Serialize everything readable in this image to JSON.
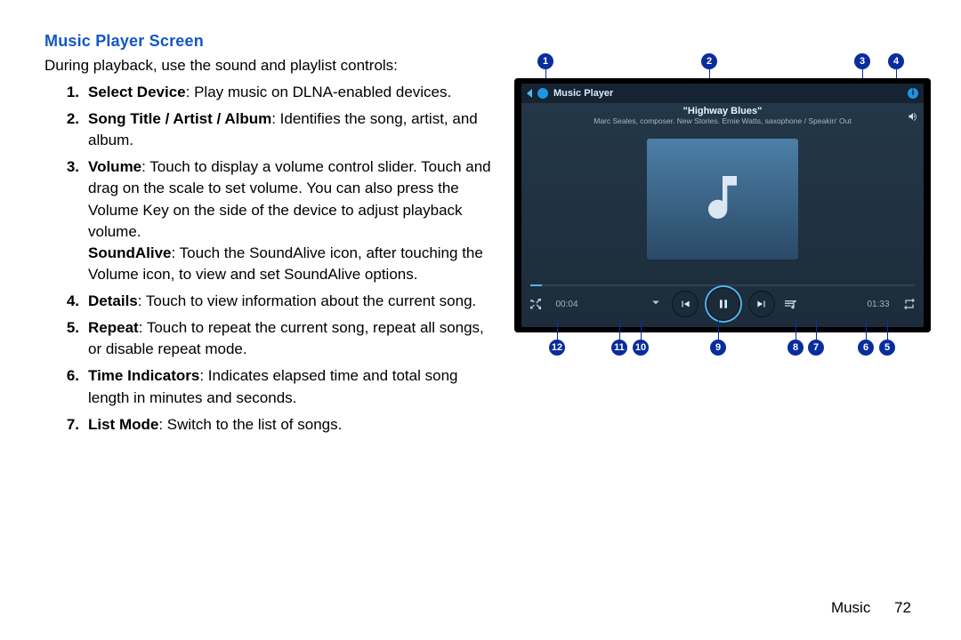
{
  "heading": "Music Player Screen",
  "intro": "During playback, use the sound and playlist controls:",
  "items": [
    {
      "num": "1.",
      "term": "Select Device",
      "rest": ": Play music on DLNA-enabled devices."
    },
    {
      "num": "2.",
      "term": "Song Title / Artist / Album",
      "rest": ": Identifies the song, artist, and album."
    },
    {
      "num": "3.",
      "term": "Volume",
      "rest": ": Touch to display a volume control slider. Touch and drag on the scale to set volume. You can also press the Volume Key on the side of the device to adjust playback volume.",
      "extra_term": "SoundAlive",
      "extra_rest": ": Touch the SoundAlive icon, after touching the Volume icon, to view and set SoundAlive options."
    },
    {
      "num": "4.",
      "term": "Details",
      "rest": ": Touch to view information about the current song."
    },
    {
      "num": "5.",
      "term": "Repeat",
      "rest": ": Touch to repeat the current song, repeat all songs, or disable repeat mode."
    },
    {
      "num": "6.",
      "term": "Time Indicators",
      "rest": ": Indicates elapsed time and total song length in minutes and seconds."
    },
    {
      "num": "7.",
      "term": "List Mode",
      "rest": ": Switch to the list of songs."
    }
  ],
  "footer": {
    "section": "Music",
    "page": "72"
  },
  "player": {
    "app_title": "Music Player",
    "song_title": "\"Highway Blues\"",
    "song_meta": "Marc Seales, composer. New Stories. Ernie Watts, saxophone / Speakin' Out",
    "elapsed": "00:04",
    "total": "01:33"
  },
  "callouts_top": [
    "1",
    "2",
    "3",
    "4"
  ],
  "callouts_bottom": [
    "12",
    "11",
    "10",
    "9",
    "8",
    "7",
    "6",
    "5"
  ]
}
